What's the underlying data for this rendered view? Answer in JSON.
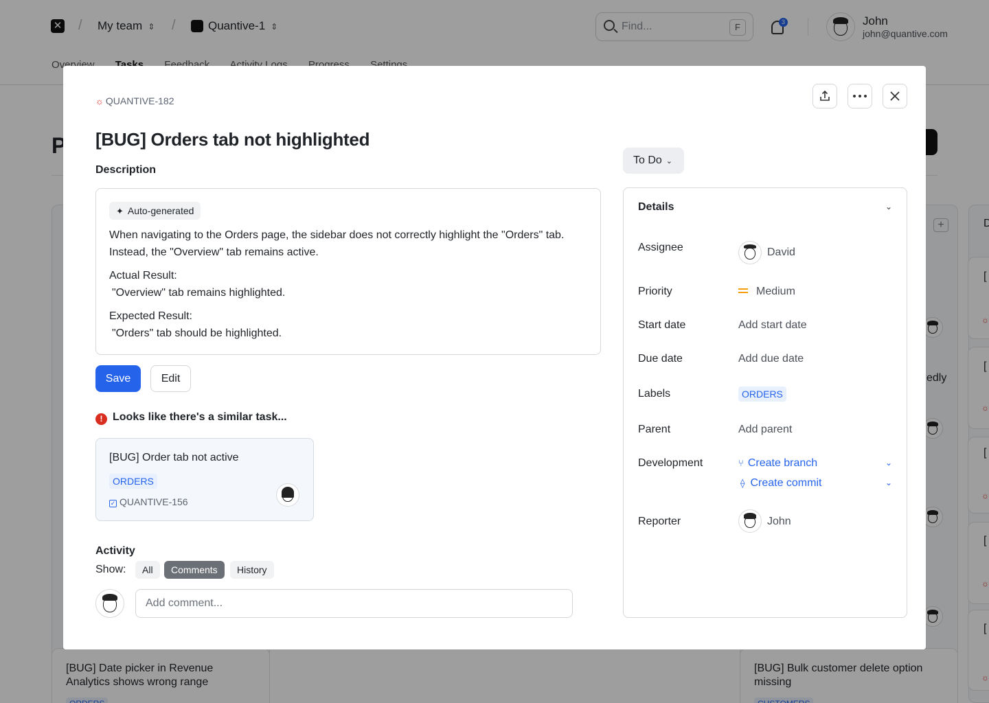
{
  "topbar": {
    "team": "My team",
    "project": "Quantive-1",
    "search_placeholder": "Find...",
    "search_shortcut": "F",
    "notifications_count": "3",
    "user_name": "John",
    "user_email": "john@quantive.com"
  },
  "nav": {
    "tabs": [
      "Overview",
      "Tasks",
      "Feedback",
      "Activity Logs",
      "Progress",
      "Settings"
    ]
  },
  "background": {
    "page_letter": "P",
    "partial_text": "edly",
    "cards": [
      {
        "title": "[BUG] Date picker in Revenue Analytics shows wrong range",
        "tag": "ORDERS"
      },
      {
        "title": "[BUG] Bulk customer delete option missing",
        "tag": "CUSTOMERS"
      }
    ],
    "right_col_letters": [
      "D",
      "[",
      "[",
      "[",
      "[",
      "["
    ]
  },
  "modal": {
    "issue_key": "QUANTIVE-182",
    "title": "[BUG] Orders tab not highlighted",
    "description_label": "Description",
    "auto_generated": "Auto-generated",
    "description": "When navigating to the Orders page, the sidebar does not correctly highlight the \"Orders\" tab. Instead, the \"Overview\" tab remains active.",
    "actual_label": "Actual Result:",
    "actual_value": "\"Overview\" tab remains highlighted.",
    "expected_label": "Expected Result:",
    "expected_value": "\"Orders\" tab should be highlighted.",
    "save_label": "Save",
    "edit_label": "Edit",
    "similar_heading": "Looks like there's a similar task...",
    "similar_task": {
      "title": "[BUG] Order tab not active",
      "tag": "ORDERS",
      "key": "QUANTIVE-156"
    },
    "activity_label": "Activity",
    "show_label": "Show:",
    "filters": [
      "All",
      "Comments",
      "History"
    ],
    "selected_filter": "Comments",
    "comment_placeholder": "Add comment...",
    "status": "To Do",
    "details": {
      "title": "Details",
      "assignee_label": "Assignee",
      "assignee": "David",
      "priority_label": "Priority",
      "priority": "Medium",
      "start_label": "Start date",
      "start": "Add start date",
      "due_label": "Due date",
      "due": "Add due date",
      "labels_label": "Labels",
      "label_tag": "ORDERS",
      "parent_label": "Parent",
      "parent": "Add parent",
      "development_label": "Development",
      "create_branch": "Create branch",
      "create_commit": "Create commit",
      "reporter_label": "Reporter",
      "reporter": "John"
    }
  },
  "colors": {
    "accent": "#2563eb",
    "bug": "#d92d20",
    "priority_medium": "#f59e0b"
  }
}
